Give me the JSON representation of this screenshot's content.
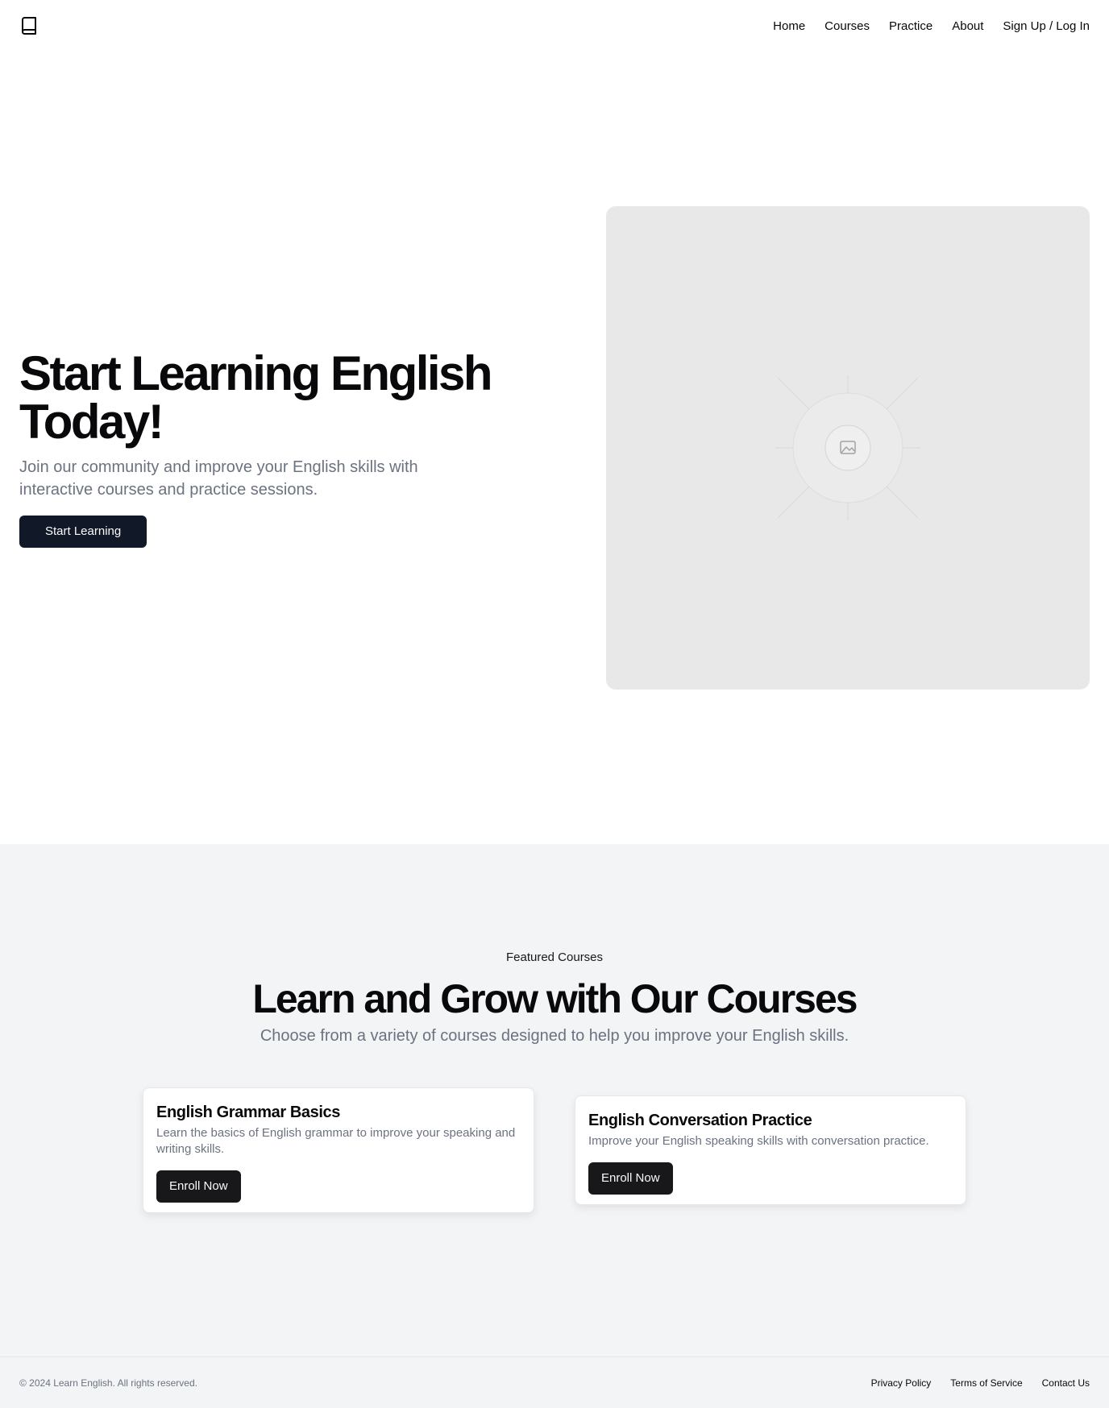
{
  "header": {
    "logo_icon": "book-icon",
    "nav": [
      {
        "label": "Home"
      },
      {
        "label": "Courses"
      },
      {
        "label": "Practice"
      },
      {
        "label": "About"
      },
      {
        "label": "Sign Up / Log In"
      }
    ]
  },
  "hero": {
    "title": "Start Learning English Today!",
    "subtitle": "Join our community and improve your English skills with interactive courses and practice sessions.",
    "cta_label": "Start Learning",
    "image_icon": "image-placeholder-icon"
  },
  "courses": {
    "eyebrow": "Featured Courses",
    "title": "Learn and Grow with Our Courses",
    "subtitle": "Choose from a variety of courses designed to help you improve your English skills.",
    "items": [
      {
        "title": "English Grammar Basics",
        "description": "Learn the basics of English grammar to improve your speaking and writing skills.",
        "button_label": "Enroll Now"
      },
      {
        "title": "English Conversation Practice",
        "description": "Improve your English speaking skills with conversation practice.",
        "button_label": "Enroll Now"
      }
    ]
  },
  "footer": {
    "copyright": "© 2024 Learn English. All rights reserved.",
    "links": [
      {
        "label": "Privacy Policy"
      },
      {
        "label": "Terms of Service"
      },
      {
        "label": "Contact Us"
      }
    ]
  },
  "colors": {
    "primary_button": "#111827",
    "enroll_button": "#18181b",
    "section_background": "#f3f4f6",
    "muted_text": "#6b7280"
  }
}
